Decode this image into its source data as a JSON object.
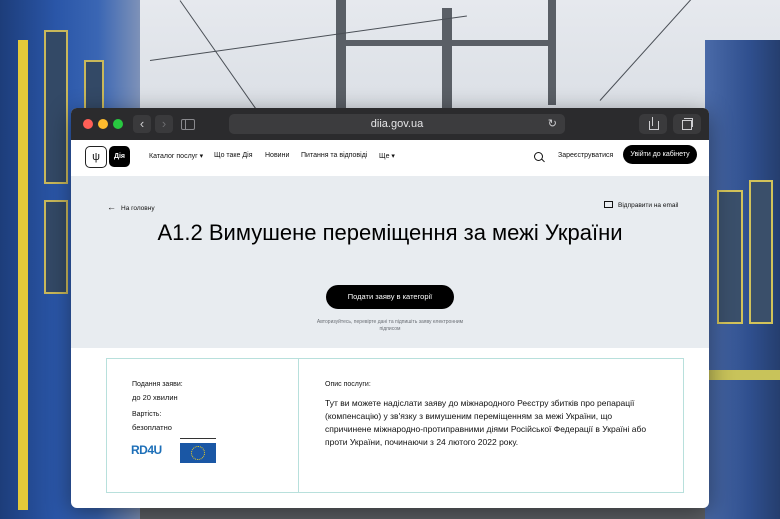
{
  "browser": {
    "url": "diia.gov.ua",
    "back_glyph": "‹",
    "forward_glyph": "›",
    "reload_glyph": "↻"
  },
  "header": {
    "trident_glyph": "ψ",
    "diia_logo": "Дія",
    "nav": [
      "Каталог послуг ▾",
      "Що таке Дія",
      "Новини",
      "Питання та відповіді",
      "Ще ▾"
    ],
    "register": "Зареєструватися",
    "login": "Увійти до кабінету"
  },
  "hero": {
    "back": "На головну",
    "email": "Відправити на email",
    "title": "А1.2 Вимушене переміщення за межі України",
    "apply": "Подати заяву в категорії",
    "note": "Авторизуйтесь, перевірте дані та підпишіть заяву електронним підписом"
  },
  "card": {
    "time_label": "Подання заяви:",
    "time_value": "до 20 хвилин",
    "cost_label": "Вартість:",
    "cost_value": "безоплатно",
    "desc_label": "Опис послуги:",
    "desc": "Тут ви можете надіслати заяву до міжнародного Реєстру збитків про репарації (компенсацію) у зв'язку з вимушеним переміщенням за межі України, що спричинене міжнародно-протиправними діями Російської Федерації в Україні або проти України, починаючи з 24 лютого 2022 року.",
    "logos": [
      "RD4U",
      "Council of Europe"
    ]
  },
  "colors": {
    "accent": "#000000",
    "hero_bg": "#e8ecf0",
    "card_border": "#b8e0dc"
  }
}
